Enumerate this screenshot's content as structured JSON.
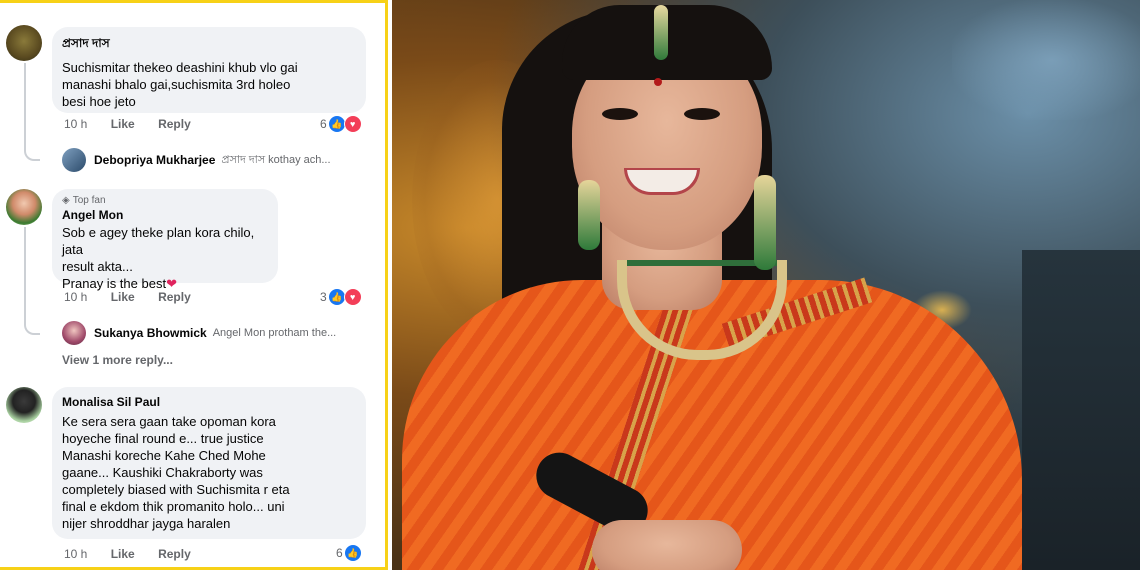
{
  "comments": [
    {
      "name": "প্রসাদ দাস",
      "text": "Suchismitar thekeo deashini khub vlo gai\nmanashi bhalo gai,suchismita 3rd holeo\nbesi hoe jeto",
      "time": "10 h",
      "like": "Like",
      "reply": "Reply",
      "reactions": "6",
      "reply_preview": {
        "name": "Debopriya Mukharjee",
        "text": "প্রসাদ দাস  kothay ach..."
      }
    },
    {
      "badge": "Top fan",
      "name": "Angel Mon",
      "text": "Sob e agey theke plan kora chilo, jata\nresult akta...\nPranay is the best",
      "heart": "❤",
      "time": "10 h",
      "like": "Like",
      "reply": "Reply",
      "reactions": "3",
      "reply_preview": {
        "name": "Sukanya Bhowmick",
        "text": "Angel Mon protham the..."
      },
      "more_replies": "View 1 more reply..."
    },
    {
      "name": "Monalisa Sil Paul",
      "text": "Ke sera sera gaan take opoman kora\nhoyeche final round e... true justice\nManashi koreche Kahe Ched Mohe\ngaane... Kaushiki Chakraborty was\ncompletely biased with Suchismita r eta\nfinal e ekdom thik promanito holo... uni\nnijer shroddhar jayga haralen",
      "time": "10 h",
      "like": "Like",
      "reply": "Reply",
      "reactions": "6"
    }
  ],
  "icons": {
    "like": "thumbs-up-icon",
    "love": "heart-icon",
    "topfan": "badge-icon"
  },
  "colors": {
    "frame": "#f7d117",
    "fb_blue": "#1877f2",
    "love_red": "#f33e58",
    "saree": "#f06a22"
  }
}
